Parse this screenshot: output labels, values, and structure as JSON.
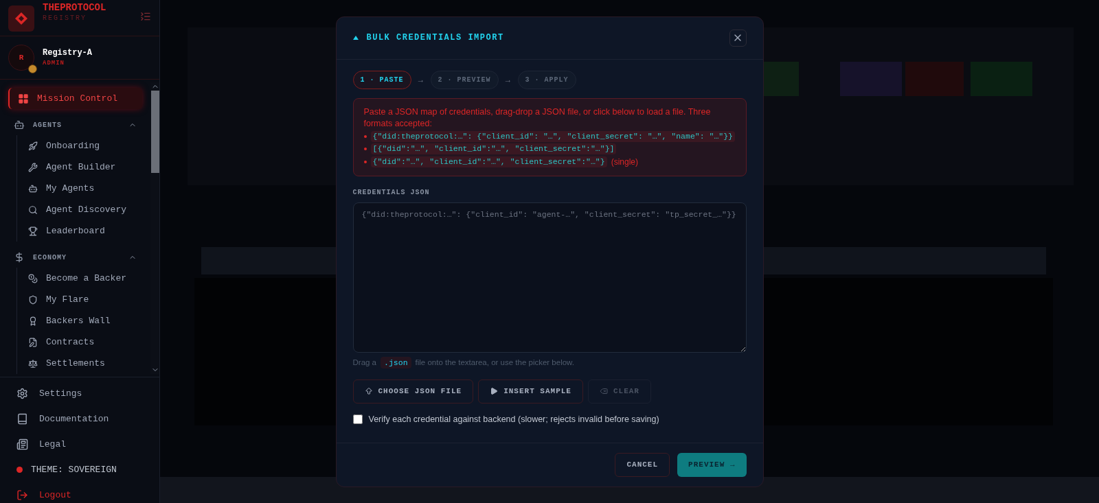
{
  "sidebar": {
    "brand": {
      "title": "THEPROTOCOL",
      "subtitle": "REGISTRY"
    },
    "user": {
      "initial": "R",
      "name": "Registry-A",
      "role": "ADMIN"
    },
    "main_item": {
      "label": "Mission Control",
      "selected": true
    },
    "sections": [
      {
        "label": "AGENTS",
        "expanded": true,
        "items": [
          {
            "label": "Onboarding",
            "selected": false
          },
          {
            "label": "Agent Builder",
            "selected": false
          },
          {
            "label": "My Agents",
            "selected": false
          },
          {
            "label": "Agent Discovery",
            "selected": false
          },
          {
            "label": "Leaderboard",
            "selected": false
          }
        ]
      },
      {
        "label": "ECONOMY",
        "expanded": true,
        "items": [
          {
            "label": "Become a Backer",
            "selected": false
          },
          {
            "label": "My Flare",
            "selected": false
          },
          {
            "label": "Backers Wall",
            "selected": false
          },
          {
            "label": "Contracts",
            "selected": false
          },
          {
            "label": "Settlements",
            "selected": false
          }
        ]
      }
    ],
    "footer_items": [
      {
        "label": "Settings"
      },
      {
        "label": "Documentation"
      },
      {
        "label": "Legal"
      }
    ],
    "theme": {
      "label": "THEME: SOVEREIGN",
      "color": "#dc2626"
    },
    "logout": {
      "label": "Logout"
    }
  },
  "modal": {
    "title": "BULK CREDENTIALS IMPORT",
    "steps": [
      {
        "label": "1 · PASTE",
        "selected": true
      },
      {
        "label": "2 · PREVIEW",
        "selected": false
      },
      {
        "label": "3 · APPLY",
        "selected": false
      }
    ],
    "step_separator": "→",
    "info": {
      "text": "Paste a JSON map of credentials, drag-drop a JSON file, or click below to load a file. Three formats accepted:",
      "formats": [
        {
          "code": "{\"did:theprotocol:…\": {\"client_id\": \"…\", \"client_secret\": \"…\", \"name\": \"…\"}}"
        },
        {
          "code": "[{\"did\":\"…\", \"client_id\":\"…\", \"client_secret\":\"…\"}]"
        },
        {
          "code": "{\"did\":\"…\", \"client_id\":\"…\", \"client_secret\":\"…\"}",
          "note": "(single)"
        }
      ]
    },
    "field_label": "CREDENTIALS JSON",
    "placeholder": "{\"did:theprotocol:…\": {\"client_id\": \"agent-…\", \"client_secret\": \"tp_secret_…\"}}",
    "hint": {
      "before": "Drag a",
      "code": ".json",
      "after": "file onto the textarea, or use the picker below."
    },
    "actions": [
      {
        "kind": "upload",
        "label": "CHOOSE JSON FILE",
        "disabled": false
      },
      {
        "kind": "play",
        "label": "INSERT SAMPLE",
        "disabled": false
      },
      {
        "kind": "erase",
        "label": "CLEAR",
        "disabled": true
      }
    ],
    "verify": {
      "label": "Verify each credential against backend (slower; rejects invalid before saving)",
      "checked": false
    },
    "cancel": "CANCEL",
    "preview": "PREVIEW →"
  }
}
